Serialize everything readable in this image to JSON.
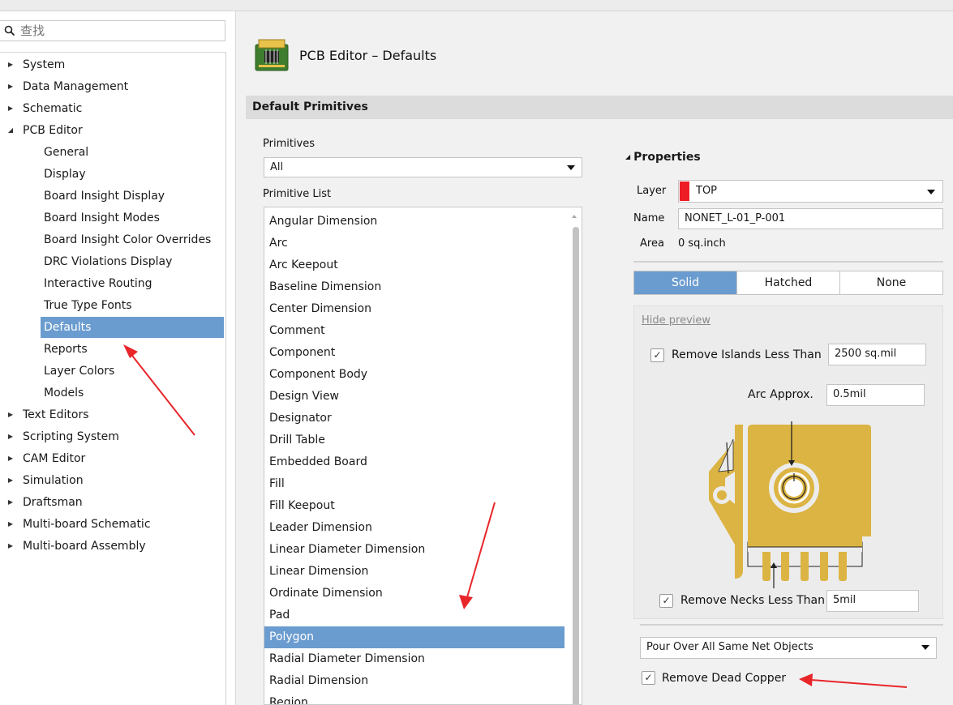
{
  "search": {
    "placeholder": "查找"
  },
  "tree": {
    "top_items": [
      "System",
      "Data Management",
      "Schematic",
      "PCB Editor",
      "Text Editors",
      "Scripting System",
      "CAM Editor",
      "Simulation",
      "Draftsman",
      "Multi-board Schematic",
      "Multi-board Assembly"
    ],
    "pcb_children": [
      "General",
      "Display",
      "Board Insight Display",
      "Board Insight Modes",
      "Board Insight Color Overrides",
      "DRC Violations Display",
      "Interactive Routing",
      "True Type Fonts",
      "Defaults",
      "Reports",
      "Layer Colors",
      "Models"
    ],
    "expanded": "PCB Editor",
    "selected": "Defaults"
  },
  "header": {
    "title": "PCB Editor – Defaults",
    "icon": "pcb-board-icon"
  },
  "section": {
    "title": "Default Primitives"
  },
  "primitives": {
    "label": "Primitives",
    "value": "All"
  },
  "primitive_list": {
    "label": "Primitive List",
    "items": [
      "Angular Dimension",
      "Arc",
      "Arc Keepout",
      "Baseline Dimension",
      "Center Dimension",
      "Comment",
      "Component",
      "Component Body",
      "Design View",
      "Designator",
      "Drill Table",
      "Embedded Board",
      "Fill",
      "Fill Keepout",
      "Leader Dimension",
      "Linear Diameter Dimension",
      "Linear Dimension",
      "Ordinate Dimension",
      "Pad",
      "Polygon",
      "Radial Diameter Dimension",
      "Radial Dimension",
      "Region"
    ],
    "selected": "Polygon"
  },
  "properties": {
    "title": "Properties",
    "layer_label": "Layer",
    "layer_value": "TOP",
    "layer_color": "#ee1c25",
    "name_label": "Name",
    "name_value": "NONET_L-01_P-001",
    "area_label": "Area",
    "area_value": "0 sq.inch",
    "fill_modes": [
      "Solid",
      "Hatched",
      "None"
    ],
    "active_mode": "Solid",
    "hide_preview": "Hide preview",
    "remove_islands_label": "Remove Islands Less Than",
    "remove_islands_checked": true,
    "remove_islands_value": "2500 sq.mil",
    "arc_approx_label": "Arc Approx.",
    "arc_approx_value": "0.5mil",
    "remove_necks_label": "Remove Necks Less Than",
    "remove_necks_checked": true,
    "remove_necks_value": "5mil",
    "pour_mode": "Pour Over All Same Net Objects",
    "remove_dead_copper_label": "Remove Dead Copper",
    "remove_dead_copper_checked": true
  },
  "colors": {
    "selection": "#6b9ccf",
    "copper": "#dcb443",
    "annotation_arrow": "#e8262a"
  },
  "checkmark": "✓"
}
